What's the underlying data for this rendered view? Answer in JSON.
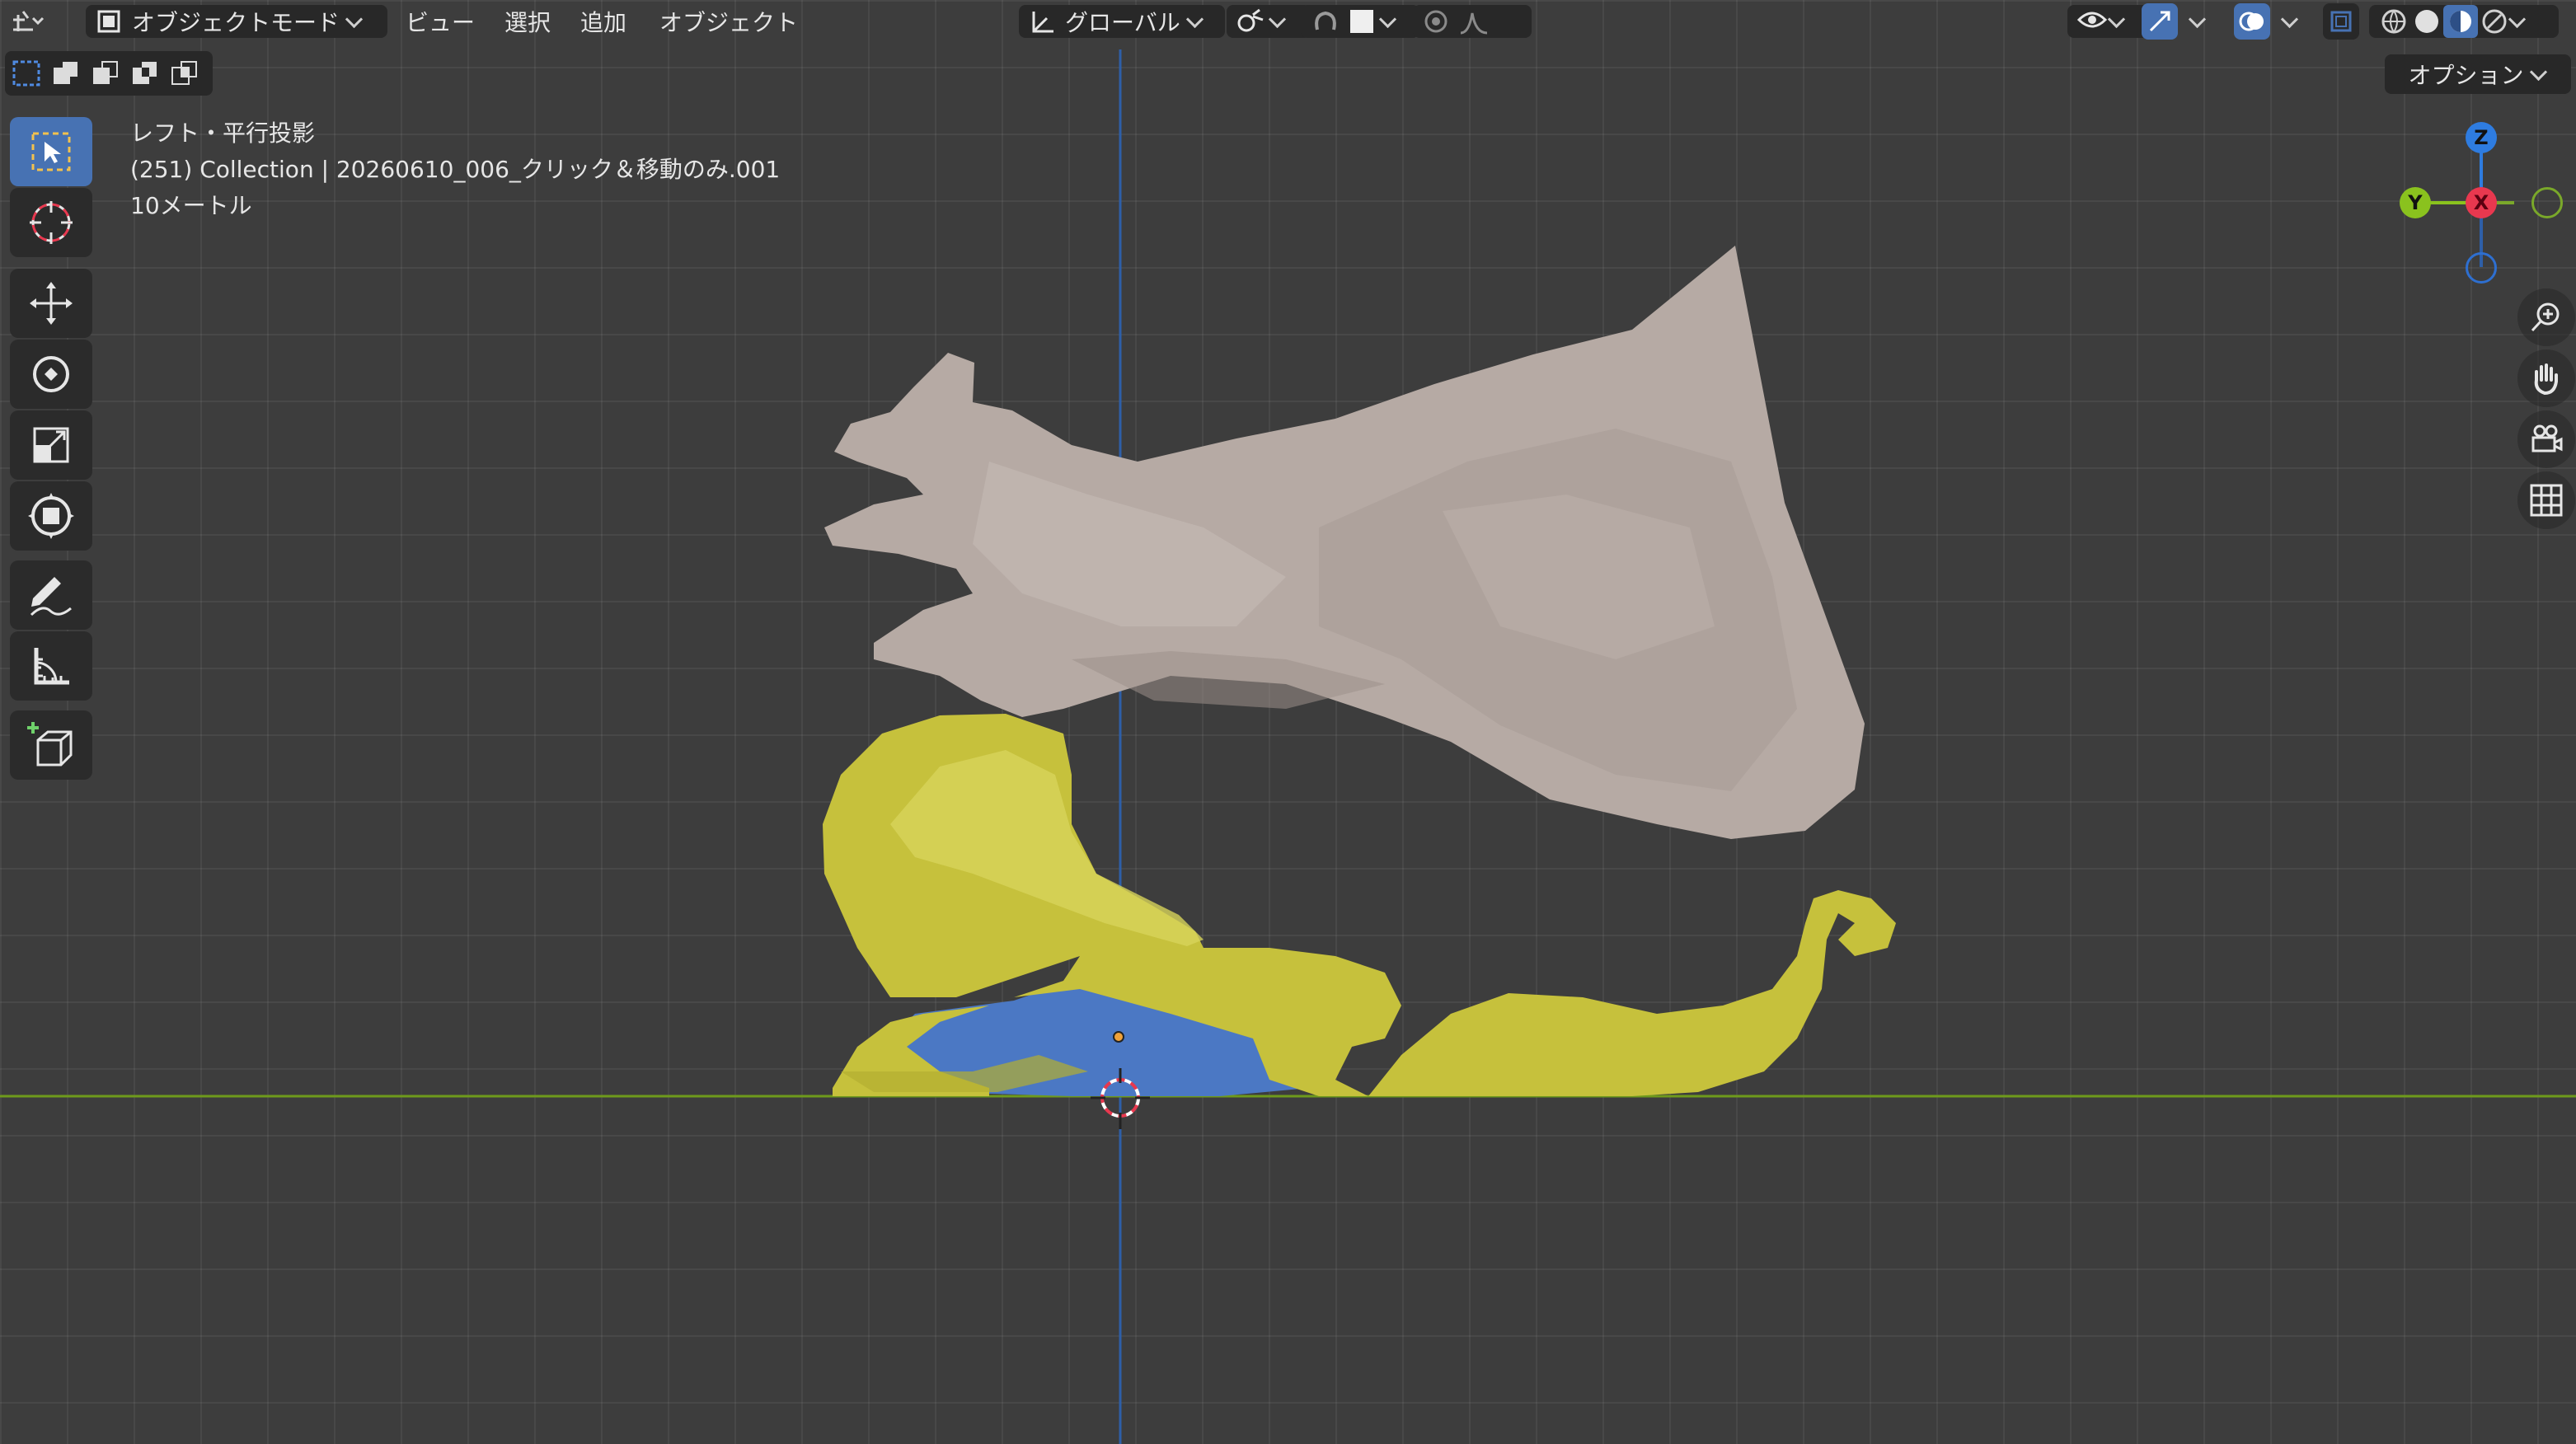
{
  "header": {
    "mode_label": "オブジェクトモード",
    "menu": [
      "ビュー",
      "選択",
      "追加",
      "オブジェクト"
    ],
    "transform_orientation": "グローバル",
    "editor_icon": "editor-type-icon",
    "mode_icon": "object-mode-icon"
  },
  "options_label": "オプション",
  "viewport_overlay": {
    "view_name": "レフト・平行投影",
    "collection_info": "(251) Collection | 20260610_006_クリック＆移動のみ.001",
    "scale_label": "10メートル"
  },
  "toolbar": {
    "tools": [
      "select-box-tool",
      "cursor-tool",
      "move-tool",
      "rotate-tool",
      "scale-tool",
      "transform-tool",
      "annotate-tool",
      "measure-tool",
      "add-cube-tool"
    ]
  },
  "gizmo": {
    "axis_z": "Z",
    "axis_y": "Y",
    "axis_x": "X"
  },
  "colors": {
    "viewport_bg": "#3d3d3d",
    "header_bg": "#282828",
    "active_blue": "#4772b3",
    "x_axis": "#e8384f",
    "y_axis": "#8ac21e",
    "z_axis": "#2e7ce0",
    "mesh_skin": "#b9aca6",
    "mesh_yellow": "#c6c13c",
    "mesh_blue": "#4b78c4"
  }
}
